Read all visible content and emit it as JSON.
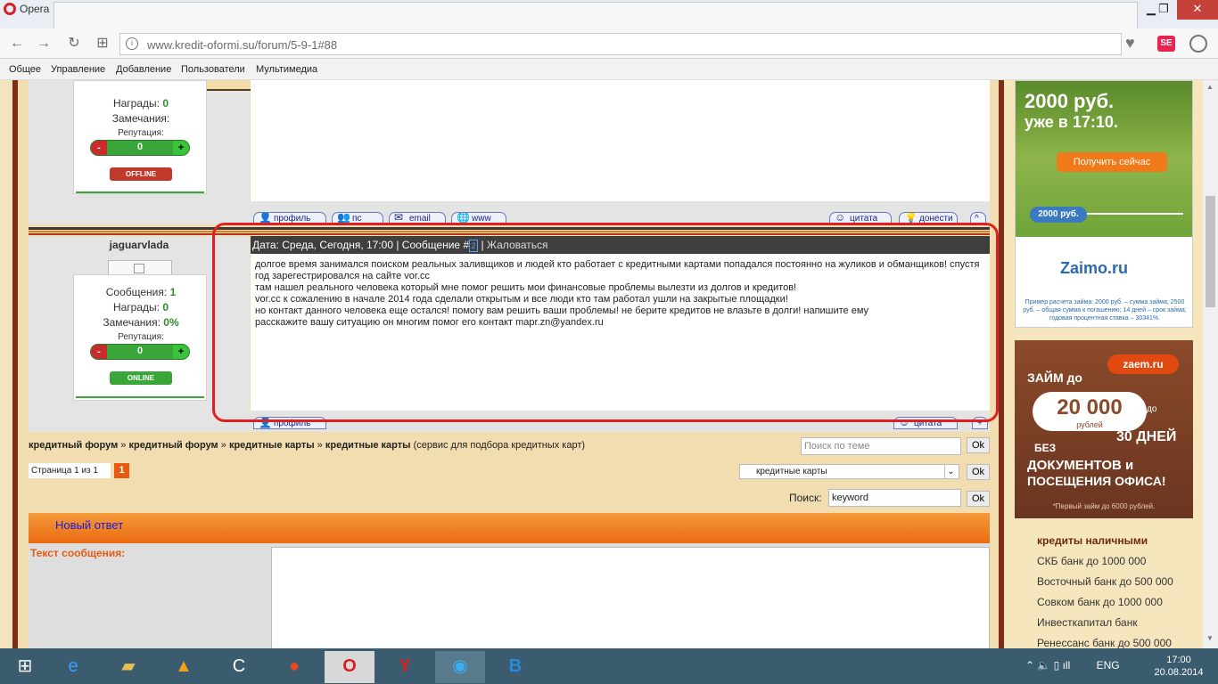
{
  "window": {
    "app_name": "Opera",
    "minimize": "▁",
    "maximize": "❐",
    "close": "✕"
  },
  "nav": {
    "back_icon": "←",
    "forward_icon": "→",
    "reload_icon": "↻",
    "grid_icon": "⊞",
    "url": "www.kredit-oformi.su/forum/5-9-1#88",
    "info_icon": "i",
    "heart_icon": "♥",
    "ext_label": "SE"
  },
  "menu": [
    "Общее",
    "Управление",
    "Добавление",
    "Пользователи",
    "Мультимедиа"
  ],
  "prev_post": {
    "awards_label": "Награды:",
    "awards_value": "0",
    "remarks_label": "Замечания:",
    "reputation_label": "Репутация:",
    "rep_minus": "-",
    "rep_value": "0",
    "rep_plus": "+",
    "status": "OFFLINE",
    "buttons": {
      "profile": "профиль",
      "pm": "пс",
      "email": "email",
      "www": "www",
      "quote": "цитата",
      "report": "донести"
    }
  },
  "post": {
    "username": "jaguarvlada",
    "header_prefix": "Дата: Среда, Сегодня, 17:00 | Сообщение #",
    "post_number": "2",
    "report_link": "Жаловаться",
    "stats": {
      "messages_label": "Сообщения:",
      "messages_value": "1",
      "awards_label": "Награды:",
      "awards_value": "0",
      "remarks_label": "Замечания:",
      "remarks_value": "0%",
      "reputation_label": "Репутация:",
      "rep_minus": "-",
      "rep_value": "0",
      "rep_plus": "+",
      "status": "ONLINE"
    },
    "lines": [
      "долгое время занимался поиском реальных заливщиков и людей кто работает с кредитными картами попадался постоянно на жуликов и обманщиков! спустя год зарегестрировался на сайте vor.cc",
      "там нашел реального человека который мне помог решить мои финансовые проблемы вылезти из долгов и кредитов!",
      "vor.cc к сожалению в начале 2014 года сделали открытым и все люди кто там работал ушли на закрытые площадки!",
      "но контакт данного человека еще остался! помогу вам решить ваши проблемы! не берите кредитов не влазьте в долги! напишите ему",
      "расскажите вашу ситуацию он многим помог его контакт mapr.zn@yandex.ru"
    ],
    "buttons": {
      "profile": "профиль",
      "quote": "цитата",
      "plus": "+"
    }
  },
  "breadcrumb": {
    "items": [
      "кредитный форум",
      "кредитный форум",
      "кредитные карты",
      "кредитные карты"
    ],
    "separator": "»",
    "description": "(сервис для подбора кредитных карт)"
  },
  "topic_search": {
    "placeholder": "Поиск по теме",
    "ok": "Ok"
  },
  "pagination": {
    "label": "Страница 1 из 1",
    "current": "1"
  },
  "forum_select": {
    "value": "кредитные карты",
    "ok": "Ok",
    "arrow": "⌄"
  },
  "search": {
    "label": "Поиск:",
    "value": "keyword",
    "ok": "Ok"
  },
  "reply": {
    "title": "Новый ответ",
    "text_label": "Текст сообщения:"
  },
  "ads": {
    "zaimo": {
      "amount": "2000 руб.",
      "time": "уже в 17:10.",
      "button": "Получить сейчас",
      "slider": "2000 руб.",
      "brand": "Zaimo.ru",
      "disclaimer": "Пример расчета займа: 2000 руб. – сумма займа; 2500 руб. – общая сумма к погашению; 14 дней – срок займа; годовая процентная ставка – 30341%."
    },
    "ezaem": {
      "brand": "zaem.ru",
      "loan": "ЗАЙМ до",
      "sum": "20 000",
      "currency": "рублей",
      "to": "до",
      "days": "30 ДНЕЙ",
      "without": "БЕЗ",
      "docs": "ДОКУМЕНТОВ и",
      "visit": "ПОСЕЩЕНИЯ ОФИСА!",
      "footnote": "*Первый займ до 6000 рублей."
    }
  },
  "sidebar": {
    "heading": "кредиты наличными",
    "links": [
      "СКБ банк до 1000 000",
      "Восточный банк до 500 000",
      "Совком банк до 1000 000",
      "Инвесткапитал банк",
      "Ренессанс банк до 500 000"
    ]
  },
  "taskbar": {
    "lang": "ENG",
    "time": "17:00",
    "date": "20.08.2014",
    "tray_icons": "⌃ 🔈 ▯ ıll"
  }
}
